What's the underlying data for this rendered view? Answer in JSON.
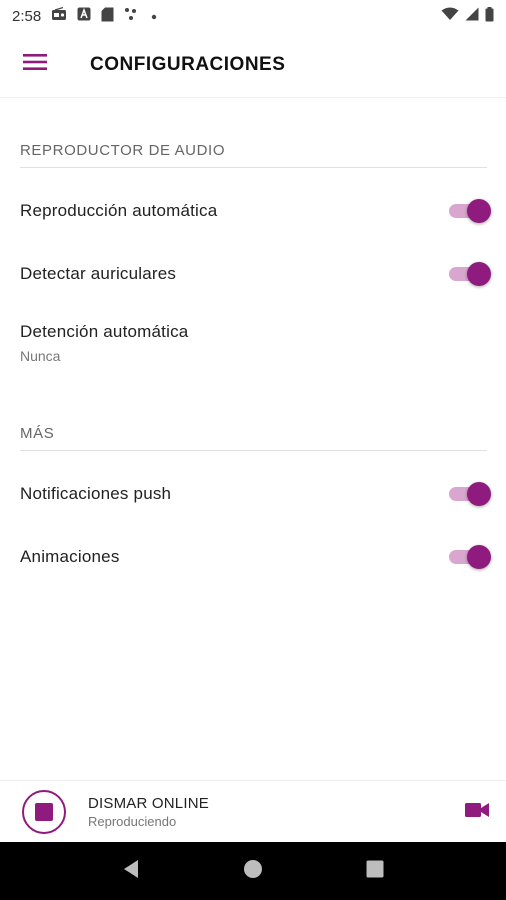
{
  "status_bar": {
    "time": "2:58",
    "icons_left": [
      "radio-icon",
      "a-icon",
      "sd-card-icon",
      "dots-icon",
      "small-dot-icon"
    ],
    "icons_right": [
      "wifi-icon",
      "signal-icon",
      "battery-icon"
    ]
  },
  "app_bar": {
    "title": "CONFIGURACIONES",
    "menu_icon": "hamburger-menu-icon"
  },
  "sections": {
    "audio": {
      "header": "REPRODUCTOR DE AUDIO",
      "items": [
        {
          "label": "Reproducción automática",
          "toggle_on": true
        },
        {
          "label": "Detectar auriculares",
          "toggle_on": true
        },
        {
          "label": "Detención automática",
          "sub": "Nunca"
        }
      ]
    },
    "more": {
      "header": "MÁS",
      "items": [
        {
          "label": "Notificaciones push",
          "toggle_on": true
        },
        {
          "label": "Animaciones",
          "toggle_on": true
        }
      ]
    }
  },
  "player": {
    "title": "DISMAR ONLINE",
    "status": "Reproduciendo",
    "stop_icon": "stop-icon",
    "video_icon": "videocam-icon"
  },
  "nav_bar": {
    "back_icon": "back-triangle-icon",
    "home_icon": "home-circle-icon",
    "recents_icon": "recents-square-icon"
  },
  "colors": {
    "accent": "#8e1b7d",
    "accent_light": "#d9a6cf",
    "nav_bg": "#000000"
  }
}
